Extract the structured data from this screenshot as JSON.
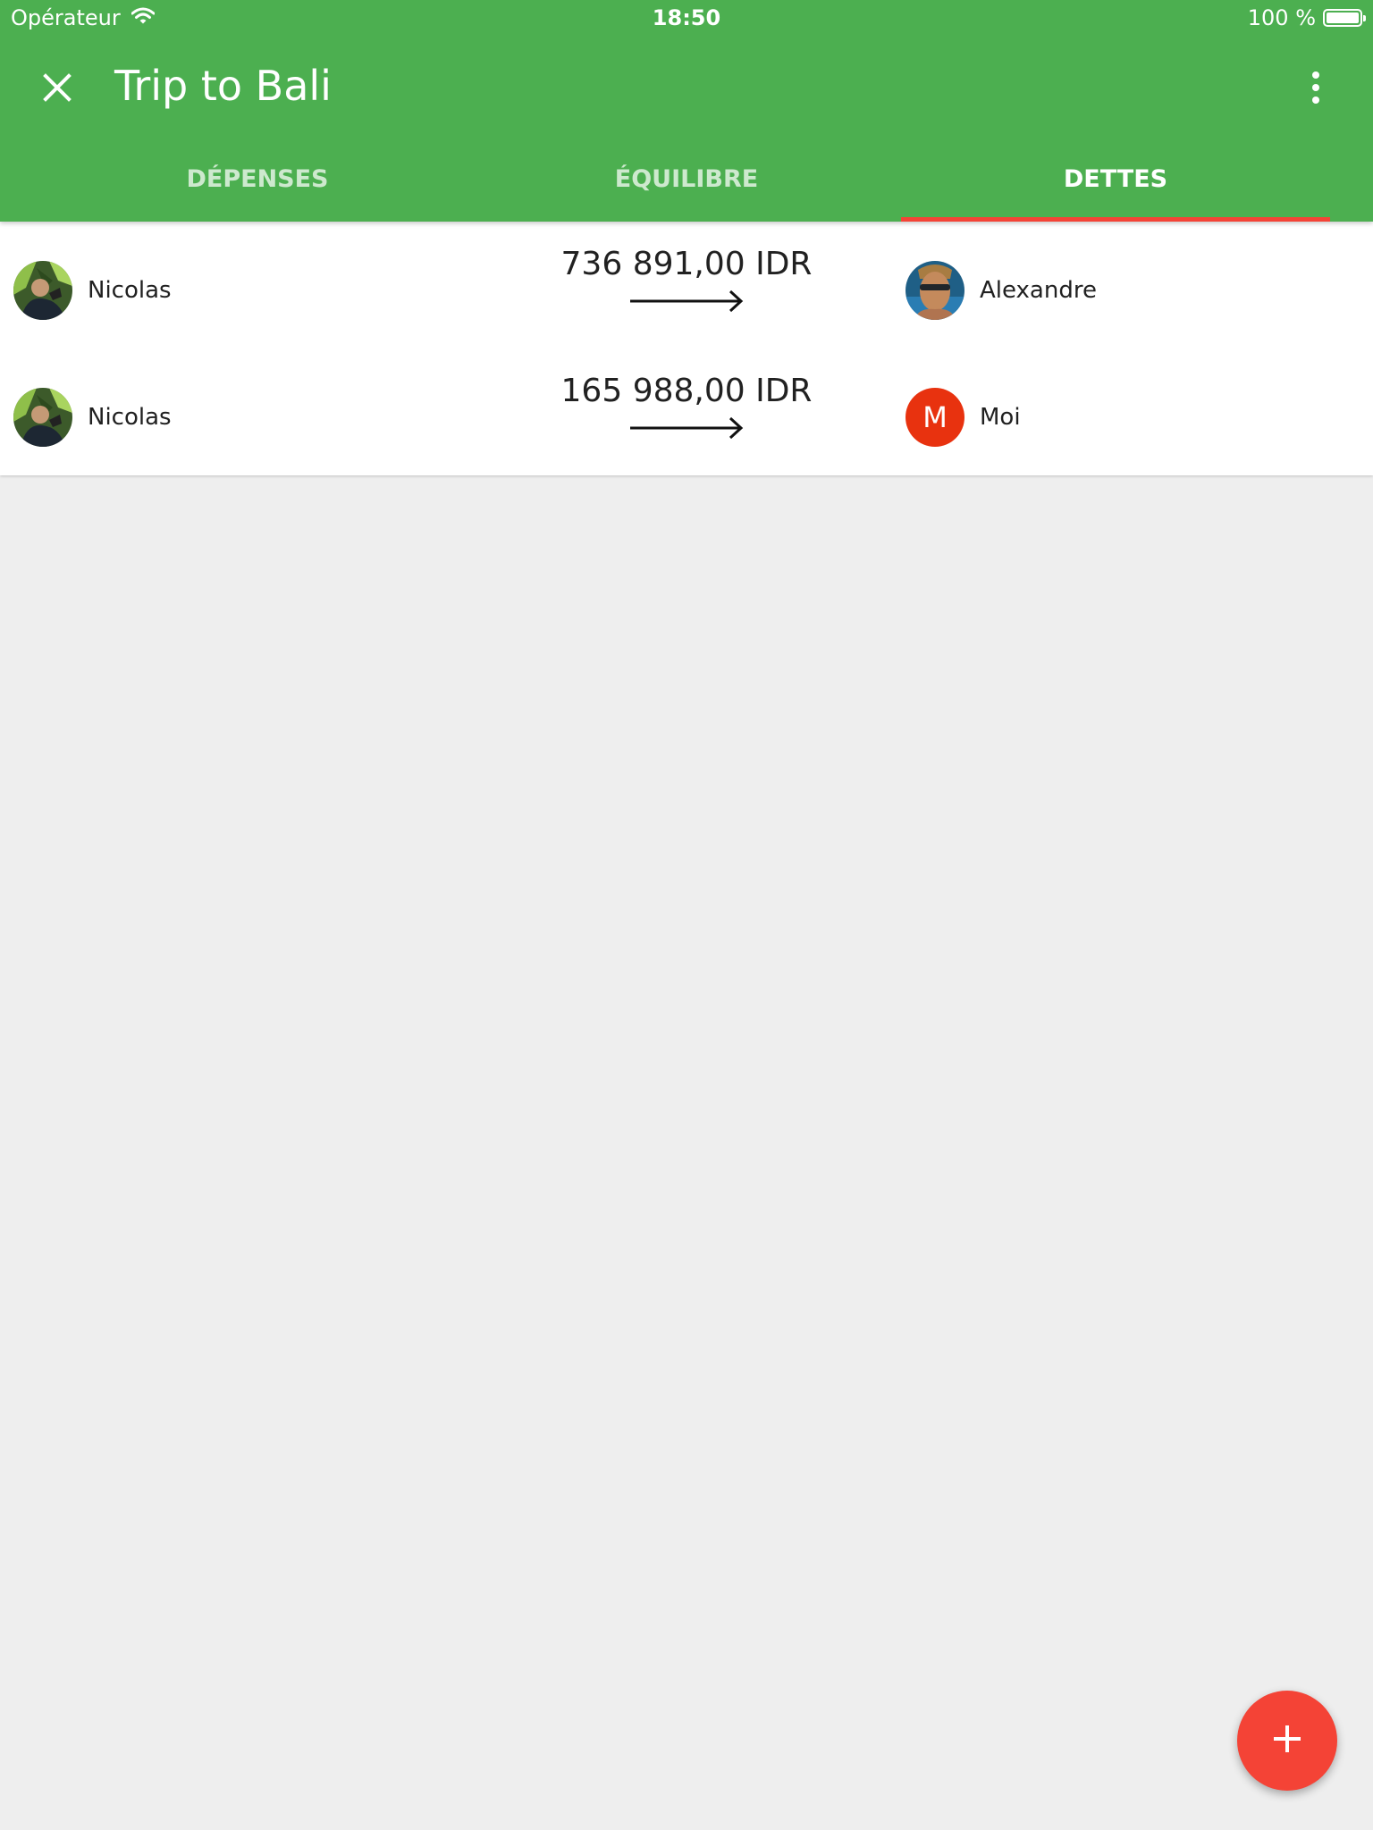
{
  "status_bar": {
    "carrier": "Opérateur",
    "time": "18:50",
    "battery": "100 %",
    "battery_level": 1.0
  },
  "toolbar": {
    "close_icon": "close-icon",
    "title": "Trip to Bali",
    "more_icon": "more-vert-icon"
  },
  "tabs": [
    {
      "label": "DÉPENSES",
      "active": false
    },
    {
      "label": "ÉQUILIBRE",
      "active": false
    },
    {
      "label": "DETTES",
      "active": true
    }
  ],
  "debts": [
    {
      "from": "Nicolas",
      "amount": "736 891,00 IDR",
      "to": "Alexandre"
    },
    {
      "from": "Nicolas",
      "amount": "165 988,00 IDR",
      "to": "Moi",
      "to_initial": "M"
    }
  ],
  "fab": {
    "icon": "add-icon"
  },
  "colors": {
    "primary": "#4caf50",
    "accent": "#f44336",
    "avatar_moi": "#e8320f",
    "background": "#eeeeee"
  }
}
